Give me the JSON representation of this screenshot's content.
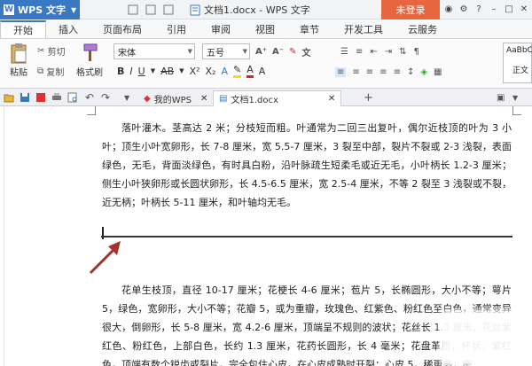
{
  "titlebar": {
    "app_name": "WPS 文字",
    "logo_letter": "W",
    "document_title": "文档1.docx - WPS 文字",
    "login_label": "未登录"
  },
  "ribbon_tabs": [
    "开始",
    "插入",
    "页面布局",
    "引用",
    "审阅",
    "视图",
    "章节",
    "开发工具",
    "云服务"
  ],
  "ribbon": {
    "paste_label": "粘贴",
    "cut_label": "剪切",
    "copy_label": "复制",
    "format_painter_label": "格式刷",
    "font_name": "宋体",
    "font_size": "五号",
    "style_preview": "AaBbC",
    "style_label": "正文"
  },
  "doc_tabs": {
    "home_tab": "我的WPS",
    "doc_tab": "文档1.docx"
  },
  "document": {
    "para1": "落叶灌木。茎高达 2 米；分枝短而粗。叶通常为二回三出复叶，偶尔近枝顶的叶为 3 小叶；顶生小叶宽卵形，长 7-8 厘米，宽 5.5-7 厘米，3 裂至中部，裂片不裂或 2-3 浅裂，表面绿色，无毛，背面淡绿色，有时具白粉，沿叶脉疏生短柔毛或近无毛，小叶柄长 1.2-3 厘米；侧生小叶狭卵形或长圆状卵形，长 4.5-6.5 厘米，宽 2.5-4 厘米，不等 2 裂至 3 浅裂或不裂，近无柄；叶柄长 5-11 厘米，和叶轴均无毛。",
    "para2": "花单生枝顶，直径 10-17 厘米；花梗长 4-6 厘米；苞片 5，长椭圆形，大小不等；萼片 5，绿色，宽卵形，大小不等；花瓣 5，或为重瓣，玫瑰色、红紫色、粉红色至白色，通常变异很大，倒卵形，长 5-8 厘米，宽 4.2-6 厘米，顶端呈不规则的波状；花丝长 1.3 厘米，花丝紫红色、粉红色，上部白色，长约 1.3 厘米，花药长圆形，长 4 毫米；花盘革质，杯状，紫红色，顶端有数个锐齿或裂片，完全包住心皮，在心皮成熟时开裂；心皮 5，稀更多，密"
  },
  "colors": {
    "accent": "#3a78c3",
    "login": "#e8663f",
    "arrow": "#a8312a"
  }
}
